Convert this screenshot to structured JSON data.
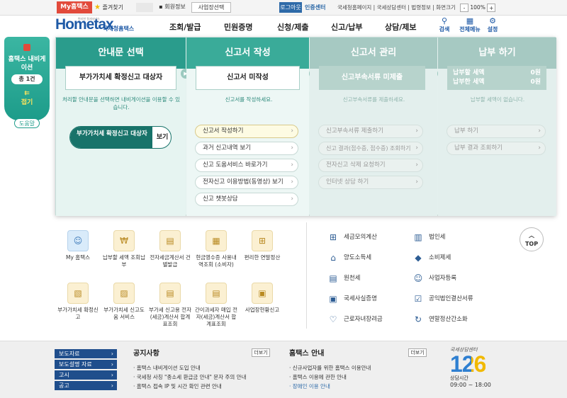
{
  "topbar": {
    "myhome": "My홈택스",
    "favorites": "즐겨찾기",
    "member_info": "회원정보",
    "business_select": "사업장선택",
    "logout": "로그아웃",
    "auth_center": "인증센터",
    "links": "국세청홈페이지 | 국세상담센터 | 법령정보 | 화면크기",
    "zoom_minus": "-",
    "zoom_value": "100%",
    "zoom_plus": "+"
  },
  "header": {
    "logo_text": "Hometax",
    "logo_sub": "국세청홈택스",
    "logo_tiny": "편리한 절세서비스",
    "menus": [
      "조회/발급",
      "민원증명",
      "신청/제출",
      "신고/납부",
      "상담/제보"
    ],
    "right_icons": [
      {
        "label": "검색",
        "icon": "search-icon"
      },
      {
        "label": "전체메뉴",
        "icon": "grid-icon"
      },
      {
        "label": "설정",
        "icon": "gear-icon"
      }
    ]
  },
  "navi": {
    "title": "홈택스 내비게이션",
    "count": "총 1건",
    "fold": "접기",
    "help": "도움말"
  },
  "panel": {
    "col1": {
      "title": "안내문 선택",
      "box": "부가가치세 확정신고 대상자",
      "desc": "처리할 안내문을 선택하면 내비게이션을 이용할 수 있습니다.",
      "selected": "부가가치세 확정신고 대상자",
      "view": "보기"
    },
    "col2": {
      "title": "신고서 작성",
      "box": "신고서 미작성",
      "desc": "신고서를 작성하세요.",
      "items": [
        "신고서 작성하기",
        "과거 신고내역 보기",
        "신고 도움서비스 바로가기",
        "전자신고 이용방법(동영상) 보기",
        "신고 챗봇상담"
      ]
    },
    "col3": {
      "title": "신고서 관리",
      "box": "신고부속서류 미제출",
      "desc": "신고부속서류를 제출하세요.",
      "items": [
        "신고부속서류 제출하기",
        "신고 결과(접수증, 접수증) 조회하기",
        "전자신고 삭제 요청하기",
        "인터넷 상담 하기"
      ]
    },
    "col4": {
      "title": "납부 하기",
      "due_label": "납부할 세액",
      "due_value": "0원",
      "paid_label": "납부한 세액",
      "paid_value": "0원",
      "desc": "납부할 세액이 없습니다.",
      "items": [
        "납부 하기",
        "납부 결과 조회하기"
      ]
    }
  },
  "quick_icons": [
    {
      "label": "My 홈택스"
    },
    {
      "label": "납부할 세액 조회납부"
    },
    {
      "label": "전자세금계산서 건별발급"
    },
    {
      "label": "현금영수증 사용내역조회 (소비자)"
    },
    {
      "label": "편리한 연말정산"
    },
    {
      "label": "부가가치세 확정신고"
    },
    {
      "label": "부가가치세 신고도움 서비스"
    },
    {
      "label": "부가세 신고용 전자(세금)계산서 합계표조회"
    },
    {
      "label": "간이과세자 매입 전자(세금)계산서 합계표조회"
    },
    {
      "label": "사업장현황신고"
    }
  ],
  "right_links": {
    "col1": [
      "세금모의계산",
      "양도소득세",
      "원천세",
      "국세사실증명",
      "근로자녀장려금"
    ],
    "col2": [
      "법인세",
      "소비제세",
      "사업자등록",
      "공익법인결산서류",
      "연말정산간소화"
    ]
  },
  "top_button": "TOP",
  "footer": {
    "left_menu": [
      "보도자료",
      "보도설명 자료",
      "고시",
      "공고"
    ],
    "notice_title": "공지사항",
    "notice_more": "더보기",
    "notices": [
      "홈택스 내비게이션 도입 안내",
      "국세청 사칭 \"종소세 환급금 안내\" 문자 주의 안내",
      "홈택스 접속 IP 및 시간 확인 관련 안내"
    ],
    "guide_title": "홈택스 안내",
    "guide_more": "더보기",
    "guides": [
      "신규사업자를 위한 홈택스 이용안내",
      "홈택스 이용에 관한 안내",
      "장애인 이용 안내"
    ],
    "center_name": "국세상담센터",
    "center_number": "126",
    "center_hours_label": "상담시간",
    "center_hours": "09:00 ~ 18:00"
  }
}
